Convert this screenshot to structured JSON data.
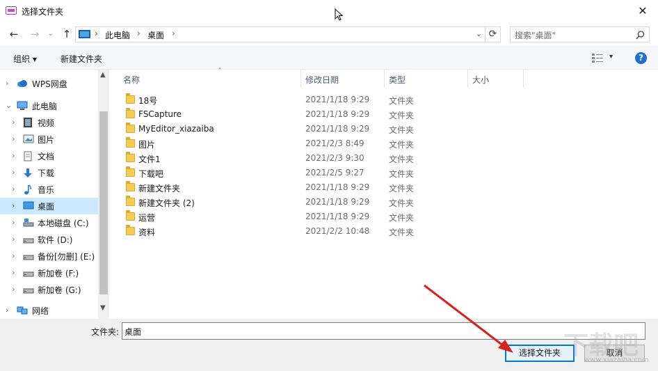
{
  "window": {
    "title": "选择文件夹",
    "close_glyph": "✕"
  },
  "nav_buttons": {
    "back": "←",
    "forward": "→",
    "recent": "⌄",
    "up": "↑"
  },
  "address": {
    "segments": [
      "此电脑",
      "桌面"
    ],
    "separator": "›"
  },
  "search": {
    "placeholder": "搜索\"桌面\""
  },
  "toolbar": {
    "organize": "组织 ▾",
    "new_folder": "新建文件夹",
    "help": "?"
  },
  "nav_pane": {
    "items": [
      {
        "label": "WPS网盘",
        "icon": "cloud-icon",
        "expander": "›"
      },
      {
        "label": "此电脑",
        "icon": "computer-icon",
        "expander": "⌄"
      },
      {
        "label": "视频",
        "icon": "video-icon",
        "expander": "›"
      },
      {
        "label": "图片",
        "icon": "pictures-icon",
        "expander": "›"
      },
      {
        "label": "文档",
        "icon": "documents-icon",
        "expander": "›"
      },
      {
        "label": "下载",
        "icon": "download-icon",
        "expander": "›"
      },
      {
        "label": "音乐",
        "icon": "music-icon",
        "expander": "›"
      },
      {
        "label": "桌面",
        "icon": "desktop-icon",
        "expander": "›",
        "selected": true
      },
      {
        "label": "本地磁盘 (C:)",
        "icon": "system-drive-icon",
        "expander": "›"
      },
      {
        "label": "软件 (D:)",
        "icon": "drive-icon",
        "expander": "›"
      },
      {
        "label": "备份[勿删] (E:)",
        "icon": "drive-icon",
        "expander": "›"
      },
      {
        "label": "新加卷 (F:)",
        "icon": "drive-icon",
        "expander": "›"
      },
      {
        "label": "新加卷 (G:)",
        "icon": "drive-icon",
        "expander": "›"
      },
      {
        "label": "网络",
        "icon": "network-icon",
        "expander": "›"
      }
    ]
  },
  "columns": [
    "名称",
    "修改日期",
    "类型",
    "大小"
  ],
  "files": [
    {
      "name": "18号",
      "date": "2021/1/18 9:29",
      "type": "文件夹"
    },
    {
      "name": "FSCapture",
      "date": "2021/1/18 9:29",
      "type": "文件夹"
    },
    {
      "name": "MyEditor_xiazaiba",
      "date": "2021/1/18 9:29",
      "type": "文件夹"
    },
    {
      "name": "图片",
      "date": "2021/2/3 8:49",
      "type": "文件夹"
    },
    {
      "name": "文件1",
      "date": "2021/2/3 9:30",
      "type": "文件夹"
    },
    {
      "name": "下载吧",
      "date": "2021/2/5 9:27",
      "type": "文件夹"
    },
    {
      "name": "新建文件夹",
      "date": "2021/1/18 9:29",
      "type": "文件夹"
    },
    {
      "name": "新建文件夹 (2)",
      "date": "2021/1/18 9:29",
      "type": "文件夹"
    },
    {
      "name": "运营",
      "date": "2021/1/18 9:29",
      "type": "文件夹"
    },
    {
      "name": "资料",
      "date": "2021/2/2 10:48",
      "type": "文件夹"
    }
  ],
  "bottom": {
    "folder_label": "文件夹:",
    "folder_value": "桌面",
    "select_button": "选择文件夹",
    "cancel_button": "取消"
  },
  "watermark": {
    "text": "www.xiazaiba.com"
  }
}
